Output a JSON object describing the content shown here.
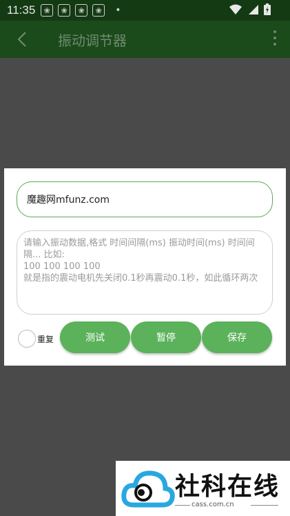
{
  "status_bar": {
    "time": "11:35",
    "notification_icons": [
      "paw-icon",
      "paw-icon",
      "paw-icon",
      "paw-icon"
    ],
    "dot": "•"
  },
  "toolbar": {
    "title": "振动调节器"
  },
  "dialog": {
    "name_value": "魔趣网mfunz.com",
    "data_placeholder": "请输入振动数据,格式 时间间隔(ms) 振动时间(ms) 时间间隔... 比如:\n100 100 100 100\n就是指的震动电机先关闭0.1秒再震动0.1秒，如此循环两次",
    "repeat_label": "重复",
    "repeat_checked": false,
    "buttons": {
      "test": "测试",
      "pause": "暂停",
      "save": "保存"
    },
    "accent_color": "#5bb25b"
  },
  "watermark": {
    "text": "社科在线",
    "url": "cass.com.cn"
  }
}
